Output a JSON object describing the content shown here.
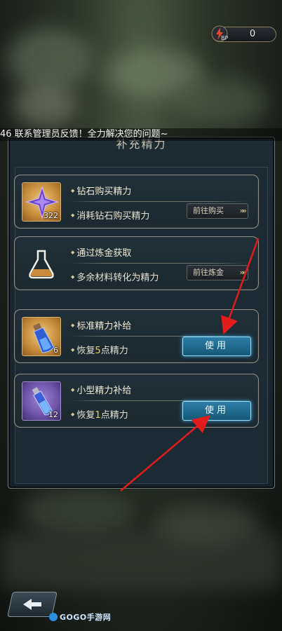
{
  "bp": {
    "value": "0",
    "icon_label": "BP",
    "icon": "bp-bolt-icon"
  },
  "notice": {
    "text": "46 联系管理员反馈！全力解决您的问题~"
  },
  "panel": {
    "title": "补充精力"
  },
  "cards": [
    {
      "title": "钻石购买精力",
      "desc": "消耗钻石购买精力",
      "qty": "322",
      "icon": "diamond-icon",
      "action": {
        "label": "前往购买",
        "arrows": "»»"
      }
    },
    {
      "title": "通过炼金获取",
      "desc": "多余材料转化为精力",
      "icon": "flask-icon",
      "action": {
        "label": "前往炼金",
        "arrows": "»»"
      }
    },
    {
      "title": "标准精力补给",
      "desc_pre": "恢复",
      "desc_num": "5",
      "desc_post": "点精力",
      "qty": "6",
      "icon": "blue-potion-icon",
      "action": {
        "label": "使用"
      }
    },
    {
      "title": "小型精力补给",
      "desc_pre": "恢复",
      "desc_num": "1",
      "desc_post": "点精力",
      "qty": "12",
      "icon": "small-potion-icon",
      "action": {
        "label": "使用"
      }
    }
  ],
  "nav": {
    "back_icon": "back-arrow-icon"
  },
  "watermark": {
    "text": "GOGO手游网"
  },
  "colors": {
    "accent": "#f3d04a",
    "use_button": "#2f7ea8",
    "annotation_arrow": "#e21b1b"
  }
}
